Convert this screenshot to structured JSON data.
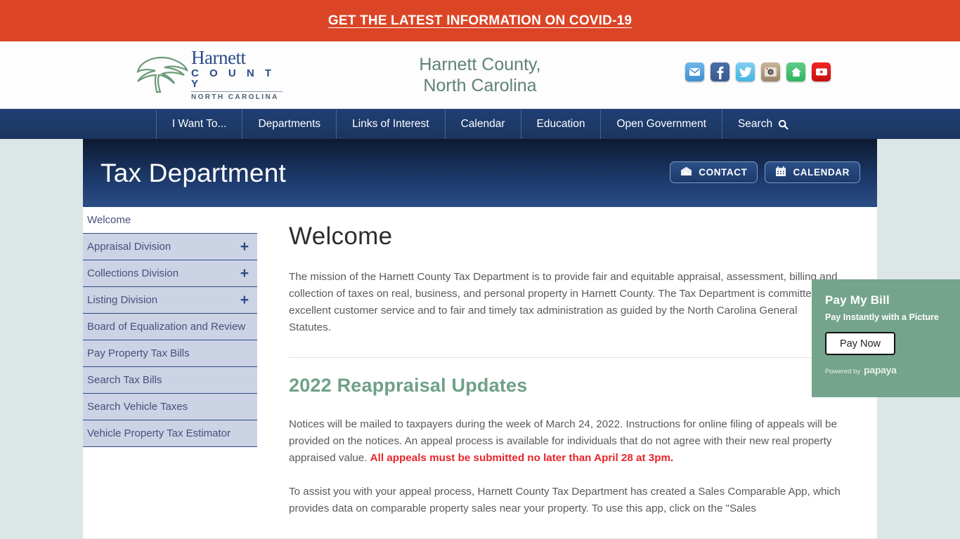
{
  "alert": {
    "text": "GET THE LATEST INFORMATION ON COVID-19",
    "bg_color": "#db4526"
  },
  "header": {
    "logo": {
      "name": "Harnett",
      "county": "C O U N T Y",
      "state": "NORTH CAROLINA",
      "icon": "tree-logo-icon"
    },
    "site_title_line1": "Harnett County,",
    "site_title_line2": "North Carolina",
    "title_color": "#5f8273",
    "social": [
      {
        "name": "email-icon",
        "label": "Email"
      },
      {
        "name": "facebook-icon",
        "label": "Facebook"
      },
      {
        "name": "twitter-icon",
        "label": "Twitter"
      },
      {
        "name": "instagram-icon",
        "label": "Instagram"
      },
      {
        "name": "nextdoor-icon",
        "label": "Nextdoor"
      },
      {
        "name": "youtube-icon",
        "label": "YouTube"
      }
    ]
  },
  "nav": {
    "bg_color": "#1f3f75",
    "items": [
      {
        "label": "I Want To..."
      },
      {
        "label": "Departments"
      },
      {
        "label": "Links of Interest"
      },
      {
        "label": "Calendar"
      },
      {
        "label": "Education"
      },
      {
        "label": "Open Government"
      },
      {
        "label": "Search",
        "icon": "search-icon"
      }
    ]
  },
  "banner": {
    "title": "Tax Department",
    "buttons": [
      {
        "label": "CONTACT",
        "icon": "envelope-icon"
      },
      {
        "label": "CALENDAR",
        "icon": "calendar-icon"
      }
    ]
  },
  "sidebar": {
    "items": [
      {
        "label": "Welcome",
        "expandable": false,
        "active": true
      },
      {
        "label": "Appraisal Division",
        "expandable": true,
        "active": false
      },
      {
        "label": "Collections Division",
        "expandable": true,
        "active": false
      },
      {
        "label": "Listing Division",
        "expandable": true,
        "active": false
      },
      {
        "label": "Board of Equalization and Review",
        "expandable": false,
        "active": false
      },
      {
        "label": "Pay Property Tax Bills",
        "expandable": false,
        "active": false
      },
      {
        "label": "Search Tax Bills",
        "expandable": false,
        "active": false
      },
      {
        "label": "Search Vehicle Taxes",
        "expandable": false,
        "active": false
      },
      {
        "label": "Vehicle Property Tax Estimator",
        "expandable": false,
        "active": false
      }
    ],
    "expand_symbol": "+"
  },
  "main": {
    "heading": "Welcome",
    "mission": "The mission of the Harnett County Tax Department is to provide fair and equitable appraisal, assessment, billing and collection of taxes on real, business, and personal property in Harnett County.  The Tax Department is committed to excellent customer service and to fair and timely tax administration as guided by the North Carolina General Statutes.",
    "section_heading": "2022 Reappraisal Updates",
    "section_heading_color": "#6fa088",
    "paragraph_1a": "Notices will be mailed to taxpayers during the week of March 24, 2022.  Instructions for online filing of appeals will be provided on the notices. An appeal process is available for individuals that do not agree with their new real property appraised value. ",
    "paragraph_1_red": "All appeals must be submitted no later than April 28 at 3pm.",
    "paragraph_2": "To assist you with your appeal process, Harnett County Tax Department has created a Sales Comparable App, which provides data on comparable property sales near your property. To use this app, click on the \"Sales"
  },
  "pay_widget": {
    "title": "Pay My Bill",
    "subtitle": "Pay Instantly with a Picture",
    "button_label": "Pay Now",
    "powered_prefix": "Powered by",
    "powered_brand": "papaya",
    "bg_color": "#74a48c"
  }
}
